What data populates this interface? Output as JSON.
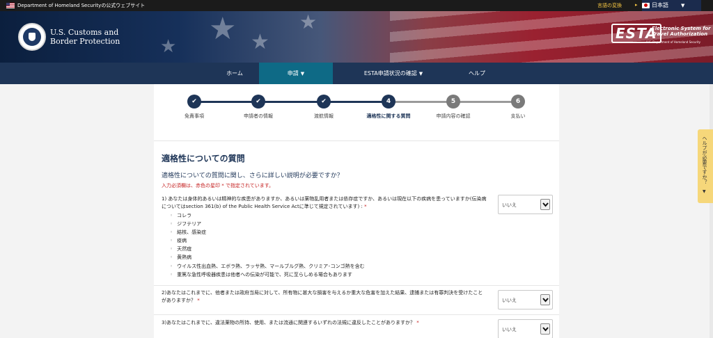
{
  "govbar": {
    "text": "Department of Homeland Securityの公式ウェブサイト",
    "language_link": "言語の変換",
    "language_selected": "日本語"
  },
  "header": {
    "agency_line1": "U.S. Customs and",
    "agency_line2": "Border Protection",
    "esta_word": "ESTA",
    "esta_sys_line1": "Electronic System for",
    "esta_sys_line2": "Travel Authorization",
    "esta_dhs": "U.S. Department of Homeland Security"
  },
  "nav": {
    "items": [
      {
        "label": "ホーム",
        "dropdown": false,
        "active": false
      },
      {
        "label": "申請",
        "dropdown": true,
        "active": true
      },
      {
        "label": "ESTA申請状況の確認",
        "dropdown": true,
        "active": false
      },
      {
        "label": "ヘルプ",
        "dropdown": false,
        "active": false
      }
    ]
  },
  "progress": {
    "steps": [
      {
        "number": "1",
        "label": "免責事項",
        "state": "done"
      },
      {
        "number": "2",
        "label": "申請者の情報",
        "state": "done"
      },
      {
        "number": "3",
        "label": "渡航情報",
        "state": "done"
      },
      {
        "number": "4",
        "label": "適格性に関する質問",
        "state": "current"
      },
      {
        "number": "5",
        "label": "申請内容の確認",
        "state": "todo"
      },
      {
        "number": "6",
        "label": "支払い",
        "state": "todo"
      }
    ]
  },
  "content": {
    "title": "適格性についての質問",
    "help_heading": "適格性についての質問に関し、さらに詳しい説明が必要ですか？",
    "required_note": "入力必須欄は、赤色の星印 * で指定されています。",
    "questions": [
      {
        "text": "1) あなたは身体的あるいは精神的な疾患がありますか、あるいは薬物乱用者または依存症ですか、あるいは現在以下の疾病を患っていますか(伝染病についてはsection 361(b) of the Public Health Service Actに準じて規定されています) :",
        "answer": "いいえ",
        "list": [
          "コレラ",
          "ジフテリア",
          "結核、感染症",
          "疫病",
          "天然痘",
          "黄熱病",
          "ウイルス性出血熱、エボラ熱、ラッサ熱、マールブルグ熱、クリミア･コンゴ熱を含む",
          "重篤な急性呼吸器疾患は他者への伝染が可能で、死に至らしめる場合もあります"
        ]
      },
      {
        "text": "2)あなたはこれまでに、他者または政府当局に対して、所有物に甚大な損害を与えるか重大な危害を加えた結果、逮捕または有罪判決を受けたことがありますか？",
        "answer": "いいえ"
      },
      {
        "text": "3)あなたはこれまでに、違法薬物の所持、使用、または流通に関連するいずれの法規に違反したことがありますか？",
        "answer": "いいえ"
      }
    ]
  },
  "side_help": {
    "label": "ヘルプが必要ですか？"
  },
  "colors": {
    "navy": "#1e3557",
    "active_nav": "#0e6a86",
    "step_todo": "#7a7a7a",
    "required_red": "#c41e1e",
    "help_tab": "#f6d77a"
  }
}
